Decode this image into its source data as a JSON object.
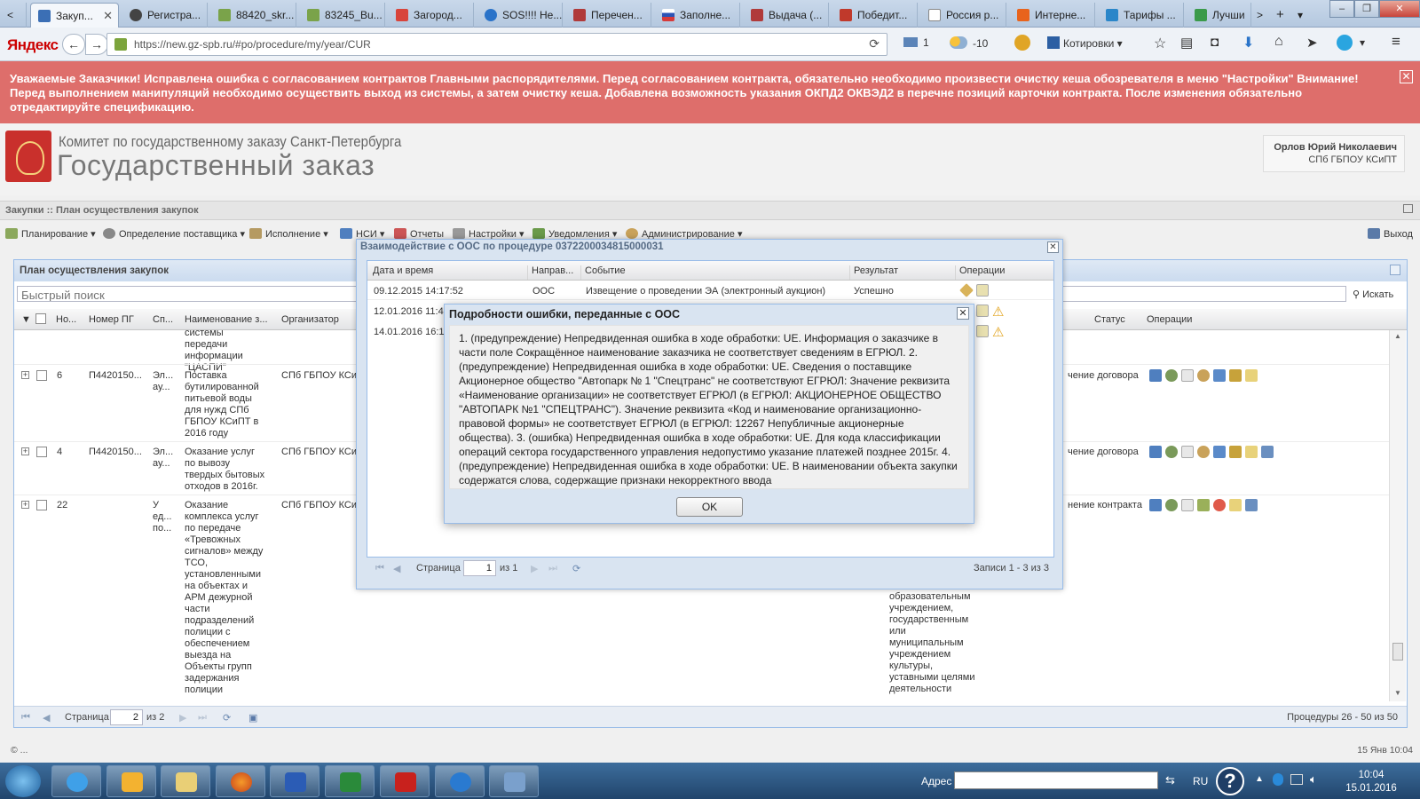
{
  "browser": {
    "tabs": [
      {
        "label": "Закуп...",
        "active": true
      },
      {
        "label": "Регистра..."
      },
      {
        "label": "88420_skr..."
      },
      {
        "label": "83245_Bu..."
      },
      {
        "label": "Загород..."
      },
      {
        "label": "SOS!!!! Не..."
      },
      {
        "label": "Перечен..."
      },
      {
        "label": "Заполне..."
      },
      {
        "label": "Выдача (..."
      },
      {
        "label": "Победит..."
      },
      {
        "label": "Россия р..."
      },
      {
        "label": "Интерне..."
      },
      {
        "label": "Тарифы ..."
      },
      {
        "label": "Лучши"
      }
    ],
    "brand": "Яндекс",
    "url": "https://new.gz-spb.ru/#po/procedure/my/year/CUR",
    "mail_count": "1",
    "weather": "-10",
    "quotes_label": "Котировки"
  },
  "alert": {
    "text": "Уважаемые Заказчики! Исправлена ошибка с согласованием контрактов Главными распорядителями. Перед согласованием контракта, обязательно необходимо произвести очистку кеша обозревателя в меню \"Настройки\" Внимание! Перед выполнением манипуляций необходимо осуществить выход из системы, а затем очистку кеша. Добавлена возможность указания ОКПД2 ОКВЭД2 в перечне позиций карточки контракта. После изменения обязательно отредактируйте спецификацию."
  },
  "header": {
    "org_line1": "Комитет по государственному заказу Санкт-Петербурга",
    "org_line2": "Государственный заказ",
    "user_name": "Орлов Юрий Николаевич",
    "user_org": "СПб ГБПОУ КСиПТ"
  },
  "module": {
    "breadcrumb": "Закупки :: План осуществления закупок"
  },
  "menu": {
    "items": [
      "Планирование",
      "Определение поставщика",
      "Исполнение",
      "НСИ",
      "Отчеты",
      "Настройки",
      "Уведомления",
      "Администрирование"
    ],
    "exit": "Выход"
  },
  "panel": {
    "title": "План осуществления закупок",
    "search_placeholder": "Быстрый поиск",
    "search_button": "Искать",
    "columns": [
      "Но...",
      "Номер ПГ",
      "Сп...",
      "Наименование з...",
      "Организатор",
      "Статус",
      "Операции"
    ],
    "partial_row_text": "системы передачи информации \"ЦАСПИ\"",
    "rows": [
      {
        "no": "6",
        "pg": "П4420150...",
        "sp": "Эл... ау...",
        "name": "Поставка бутилированной питьевой воды для нужд СПб ГБПОУ КСиПТ в 2016 году",
        "org": "СПб ГБПОУ КСиП",
        "status": "чение договора"
      },
      {
        "no": "4",
        "pg": "П4420150...",
        "sp": "Эл... ау...",
        "name": "Оказание услуг по вывозу твердых бытовых отходов в 2016г.",
        "org": "СПб ГБПОУ КСиП",
        "status": "чение договора"
      },
      {
        "no": "22",
        "pg": "",
        "sp": "У ед... по...",
        "name": "Оказание комплекса услуг по передаче «Тревожных сигналов» между ТСО, установленными на объектах и АРМ дежурной части подразделений полиции с обеспечением выезда на Объекты групп задержания полиции",
        "org": "СПб ГБПОУ КСиП",
        "status": "нение контракта"
      }
    ],
    "overflow_text": "образовательным учреждением, государственным или муниципальным учреждением культуры, уставными целями деятельности",
    "pager": {
      "page_label": "Страница",
      "page": "2",
      "of": "из 2",
      "summary": "Процедуры 26 - 50 из 50"
    }
  },
  "statusbar": {
    "left": "© ...",
    "right": "15 Янв 10:04"
  },
  "interaction_dialog": {
    "title": "Взаимодействие с ООС по процедуре 0372200034815000031",
    "columns": [
      "Дата и время",
      "Направ...",
      "Событие",
      "Результат",
      "Операции"
    ],
    "rows": [
      {
        "datetime": "09.12.2015 14:17:52",
        "direction": "ООС",
        "event": "Извещение о проведении ЭА (электронный аукцион)",
        "result": "Успешно"
      },
      {
        "datetime": "12.01.2016 11:4",
        "direction": "",
        "event": "",
        "result": ""
      },
      {
        "datetime": "14.01.2016 16:1",
        "direction": "",
        "event": "",
        "result": ""
      }
    ],
    "pager": {
      "page_label": "Страница",
      "page": "1",
      "of": "из 1",
      "summary": "Записи 1 - 3 из 3"
    }
  },
  "error_dialog": {
    "title": "Подробности ошибки, переданные с ООС",
    "text": "1. (предупреждение) Непредвиденная ошибка в ходе обработки: UE. Информация о заказчике в части поле Сокращённое наименование заказчика не соответствует сведениям в ЕГРЮЛ. 2. (предупреждение) Непредвиденная ошибка в ходе обработки: UE. Сведения о поставщике Акционерное общество \"Автопарк № 1 \"Спецтранс\" не соответствуют ЕГРЮЛ: Значение реквизита «Наименование организации» не соответствует ЕГРЮЛ (в ЕГРЮЛ: АКЦИОНЕРНОЕ ОБЩЕСТВО \"АВТОПАРК №1 \"СПЕЦТРАНС\"). Значение реквизита «Код и наименование организационно-правовой формы» не соответствует ЕГРЮЛ (в ЕГРЮЛ: 12267 Непубличные акционерные общества). 3. (ошибка) Непредвиденная ошибка в ходе обработки: UE. Для кода классификации операций сектора государственного управления недопустимо указание платежей позднее 2015г. 4. (предупреждение) Непредвиденная ошибка в ходе обработки: UE. В наименовании объекта закупки содержатся слова, содержащие признаки некорректного ввода",
    "ok": "OK"
  },
  "taskbar": {
    "address_label": "Адрес",
    "lang": "RU",
    "time": "10:04",
    "date": "15.01.2016"
  },
  "colors": {
    "alert_bg": "#de6e6b",
    "panel_border": "#99bce8",
    "logo_red": "#c9302c"
  }
}
